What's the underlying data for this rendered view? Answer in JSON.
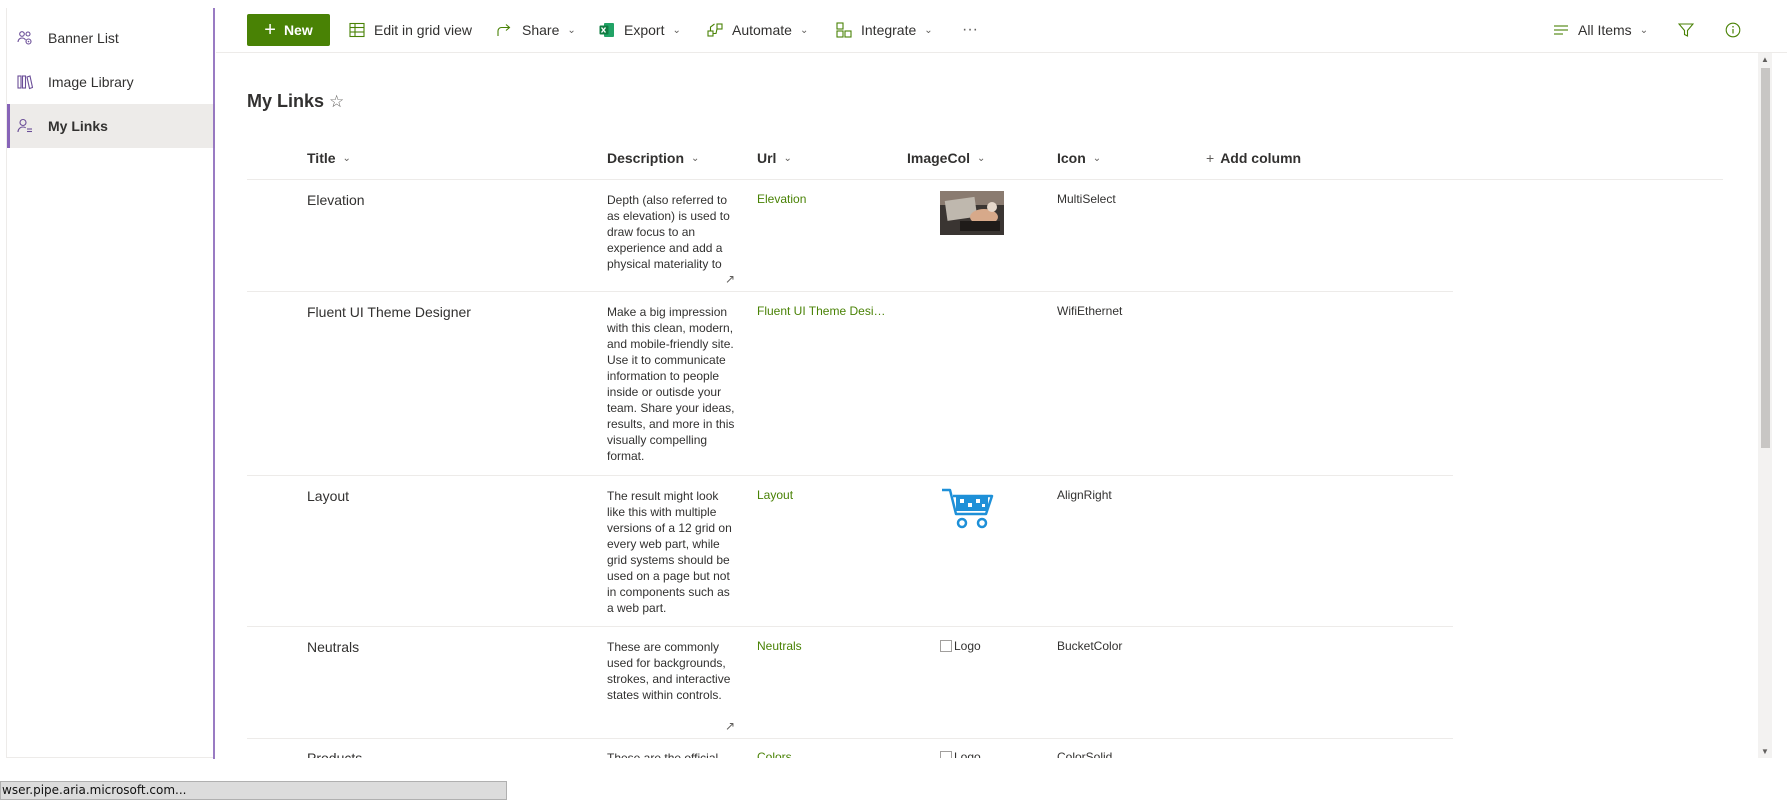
{
  "nav": {
    "items": [
      {
        "label": "Banner List",
        "icon": "people-settings-icon",
        "active": false
      },
      {
        "label": "Image Library",
        "icon": "library-icon",
        "active": false
      },
      {
        "label": "My Links",
        "icon": "person-list-icon",
        "active": true
      }
    ]
  },
  "commandbar": {
    "new_label": "New",
    "edit_grid_label": "Edit in grid view",
    "share_label": "Share",
    "export_label": "Export",
    "automate_label": "Automate",
    "integrate_label": "Integrate",
    "more_label": "···",
    "view_label": "All Items"
  },
  "page": {
    "title": "My Links"
  },
  "columns": {
    "title": "Title",
    "description": "Description",
    "url": "Url",
    "imagecol": "ImageCol",
    "icon": "Icon",
    "add_column": "Add column"
  },
  "rows": [
    {
      "title": "Elevation",
      "description": "Depth (also referred to as elevation) is used to draw focus to an experience and add a physical materiality to",
      "url": "Elevation",
      "image": "photo",
      "icon": "MultiSelect"
    },
    {
      "title": "Fluent UI Theme Designer",
      "description": "Make a big impression with this clean, modern, and mobile-friendly site. Use it to communicate information to people inside or outisde your team. Share your ideas, results, and more in this visually compelling format.",
      "url": "Fluent UI Theme Desig...",
      "image": "",
      "icon": "WifiEthernet"
    },
    {
      "title": "Layout",
      "description": "The result might look like this with multiple versions of a 12 grid on every web part, while grid systems should be used on a page but not in components such as a web part.",
      "url": "Layout",
      "image": "cart",
      "icon": "AlignRight"
    },
    {
      "title": "Neutrals",
      "description": "These are commonly used for backgrounds, strokes, and interactive states within controls.",
      "url": "Neutrals",
      "image_alt": "Logo",
      "icon": "BucketColor"
    },
    {
      "title": "Products",
      "description": "These are the official",
      "url": "Colors",
      "image_alt": "Logo",
      "icon": "ColorSolid"
    }
  ],
  "statusbar": {
    "text": "wser.pipe.aria.microsoft.com..."
  },
  "colors": {
    "accent_green": "#498205",
    "nav_accent": "#8764b8"
  }
}
